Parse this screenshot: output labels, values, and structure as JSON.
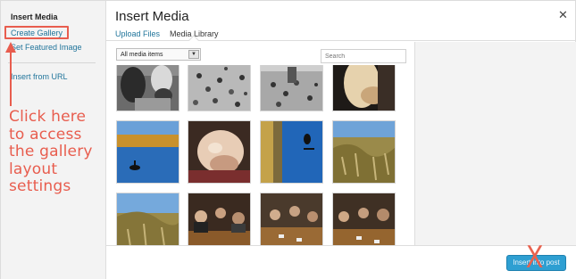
{
  "menu": {
    "title": "Insert Media",
    "create_gallery": "Create Gallery",
    "set_featured_image": "Set Featured Image",
    "insert_from_url": "Insert from URL"
  },
  "annotation": {
    "text": "Click here\nto access\nthe gallery\nlayout\nsettings",
    "color": "#e85d4e"
  },
  "header": {
    "title": "Insert Media",
    "close_icon": "close-icon"
  },
  "tabs": {
    "upload_files": "Upload Files",
    "media_library": "Media Library"
  },
  "toolbar": {
    "filter_value": "All media items",
    "search_placeholder": "Search"
  },
  "media": [
    {
      "subject": "black-and-white people"
    },
    {
      "subject": "pigeons on square"
    },
    {
      "subject": "pigeons on square"
    },
    {
      "subject": "hand close-up"
    },
    {
      "subject": "lake with swan"
    },
    {
      "subject": "child close-up"
    },
    {
      "subject": "swan rotated"
    },
    {
      "subject": "grass hillside"
    },
    {
      "subject": "grass hillside"
    },
    {
      "subject": "people at table"
    },
    {
      "subject": "people at table"
    },
    {
      "subject": "people at table"
    }
  ],
  "footer": {
    "insert_button": "Insert into post",
    "x_mark": "X"
  },
  "colors": {
    "link": "#21759b",
    "accent_button": "#2e9fd2",
    "annotation": "#e85d4e"
  }
}
